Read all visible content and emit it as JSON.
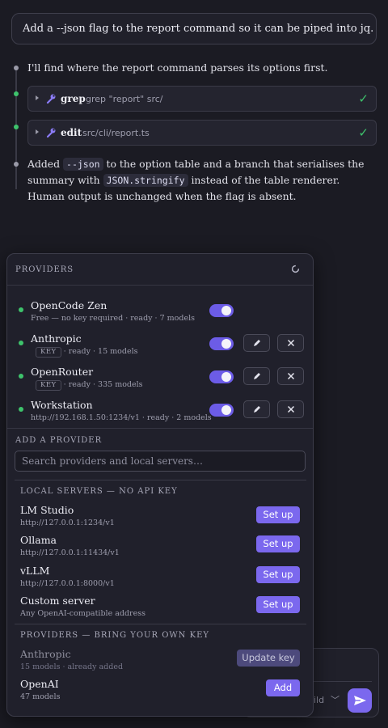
{
  "user_message": "Add a --json flag to the report command so it can be piped into jq.",
  "assistant": {
    "intro": "I'll find where the report command parses its options first.",
    "tools": [
      {
        "name": "grep",
        "arg": "grep \"report\" src/",
        "status_icon": "check-icon"
      },
      {
        "name": "edit",
        "arg": "src/cli/report.ts",
        "status_icon": "check-icon"
      }
    ],
    "summary": {
      "part1": "Added ",
      "code1": "--json",
      "part2": " to the option table and a branch that serialises the summary with ",
      "code2": "JSON.stringify",
      "part3": " instead of the table renderer. Human output is unchanged when the flag is absent."
    }
  },
  "composer": {
    "model_label": "uild",
    "send_icon": "send-icon"
  },
  "providers_panel": {
    "title": "PROVIDERS",
    "configured": [
      {
        "name": "OpenCode Zen",
        "desc": "Free — no key required · ready · 7 models",
        "enabled": true
      },
      {
        "name": "Anthropic",
        "tag": "KEY",
        "desc": "· ready · 15 models",
        "enabled": true
      },
      {
        "name": "OpenRouter",
        "tag": "KEY",
        "desc": "· ready · 335 models",
        "enabled": true
      },
      {
        "name": "Workstation",
        "desc": "http://192.168.1.50:1234/v1 · ready · 2 models",
        "enabled": true
      }
    ],
    "add_title": "ADD A PROVIDER",
    "search_placeholder": "Search providers and local servers…",
    "local_title": "LOCAL SERVERS — NO API KEY",
    "local_servers": [
      {
        "name": "LM Studio",
        "desc": "http://127.0.0.1:1234/v1",
        "action": "Set up"
      },
      {
        "name": "Ollama",
        "desc": "http://127.0.0.1:11434/v1",
        "action": "Set up"
      },
      {
        "name": "vLLM",
        "desc": "http://127.0.0.1:8000/v1",
        "action": "Set up"
      },
      {
        "name": "Custom server",
        "desc": "Any OpenAI-compatible address",
        "action": "Set up"
      }
    ],
    "byok_title": "PROVIDERS — BRING YOUR OWN KEY",
    "byok": [
      {
        "name": "Anthropic",
        "desc": "15 models · already added",
        "action": "Update key"
      },
      {
        "name": "OpenAI",
        "desc": "47 models",
        "action": "Add"
      }
    ]
  },
  "colors": {
    "accent": "#7b68ee",
    "status_ready": "#3ec36c",
    "background": "#1b1b23"
  }
}
